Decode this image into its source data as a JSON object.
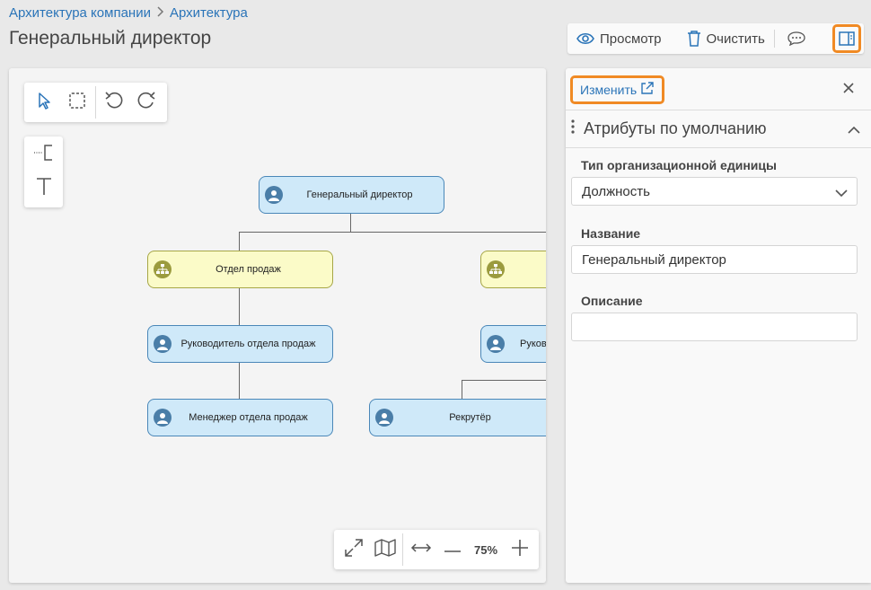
{
  "breadcrumb": {
    "items": [
      "Архитектура компании",
      "Архитектура"
    ]
  },
  "page": {
    "title": "Генеральный директор"
  },
  "toolbar": {
    "preview_label": "Просмотр",
    "clear_label": "Очистить"
  },
  "canvas": {
    "zoom": "75%",
    "nodes": {
      "ceo": "Генеральный директор",
      "sales_dept": "Отдел продаж",
      "sales_head": "Руководитель отдела продаж",
      "sales_manager": "Менеджер отдела продаж",
      "recruiter": "Рекрутёр",
      "head_2": "Руково"
    }
  },
  "panel": {
    "edit_label": "Изменить",
    "section_title": "Атрибуты по умолчанию",
    "fields": {
      "org_unit_type": {
        "label": "Тип организационной единицы",
        "value": "Должность"
      },
      "name": {
        "label": "Название",
        "value": "Генеральный директор"
      },
      "description": {
        "label": "Описание",
        "value": ""
      }
    }
  },
  "colors": {
    "accent": "#f08a24",
    "link": "#2a74b8",
    "person_node": "#cfe9f9",
    "dept_node": "#fbfbc8"
  }
}
